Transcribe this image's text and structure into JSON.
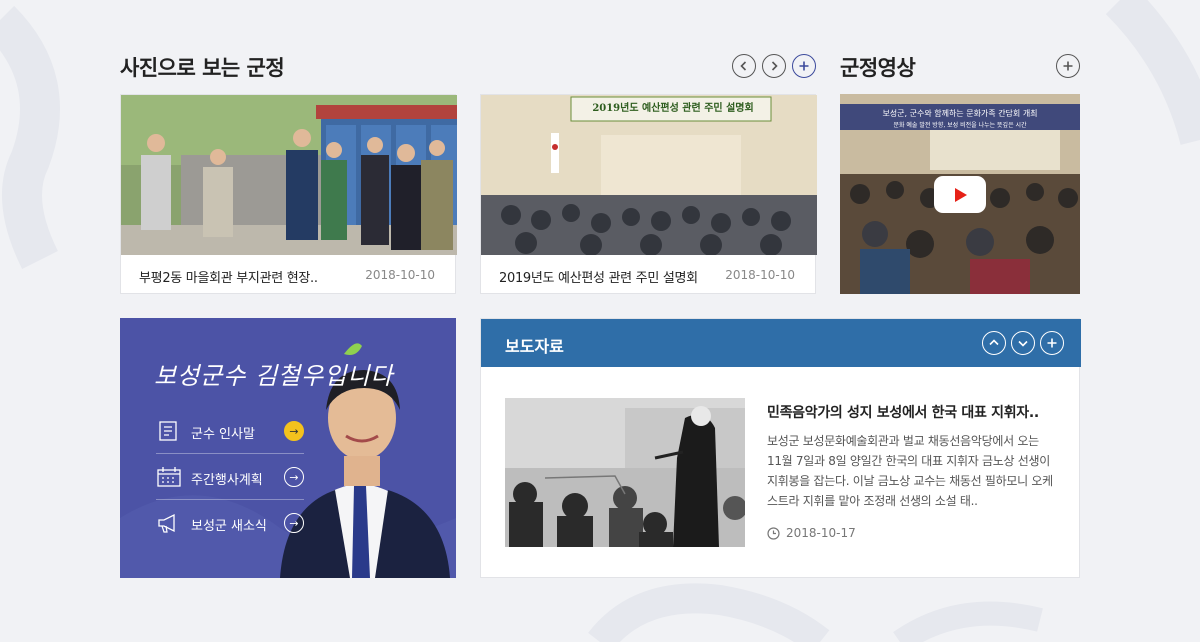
{
  "photo_section": {
    "title": "사진으로 보는 군정",
    "cards": [
      {
        "caption": "부평2동 마을회관 부지관련 현장..",
        "date": "2018-10-10"
      },
      {
        "caption": "2019년도 예산편성 관련 주민 설명회",
        "date": "2018-10-10",
        "banner": "2019년도 예산편성 관련 주민 설명회"
      }
    ]
  },
  "video_section": {
    "title": "군정영상",
    "overlay_text": "보성군, 군수와 함께하는 문화가족 간담회 개최",
    "overlay_sub": "문화 예술 발전 방향, 보성 비전을 나누는 뜻깊은 시간"
  },
  "mayor": {
    "title": "보성군수 김철우입니다",
    "menu": [
      {
        "label": "군수 인사말",
        "icon": "document-icon"
      },
      {
        "label": "주간행사계획",
        "icon": "calendar-icon"
      },
      {
        "label": "보성군 새소식",
        "icon": "megaphone-icon"
      }
    ]
  },
  "press": {
    "title": "보도자료",
    "headline": "민족음악가의 성지 보성에서 한국 대표 지휘자..",
    "body": "보성군 보성문화예술회관과 벌교 채동선음악당에서 오는 11월 7일과 8일 양일간 한국의 대표 지휘자 금노상 선생이 지휘봉을 잡는다. 이날 금노상 교수는 채동선 필하모니 오케스트라 지휘를 맡아 조정래 선생의 소설 태..",
    "date": "2018-10-17"
  },
  "colors": {
    "press_header": "#2f6ea8",
    "mayor_panel": "#4c53a6",
    "accent_yellow": "#f4c21d",
    "youtube_red": "#e62117"
  }
}
